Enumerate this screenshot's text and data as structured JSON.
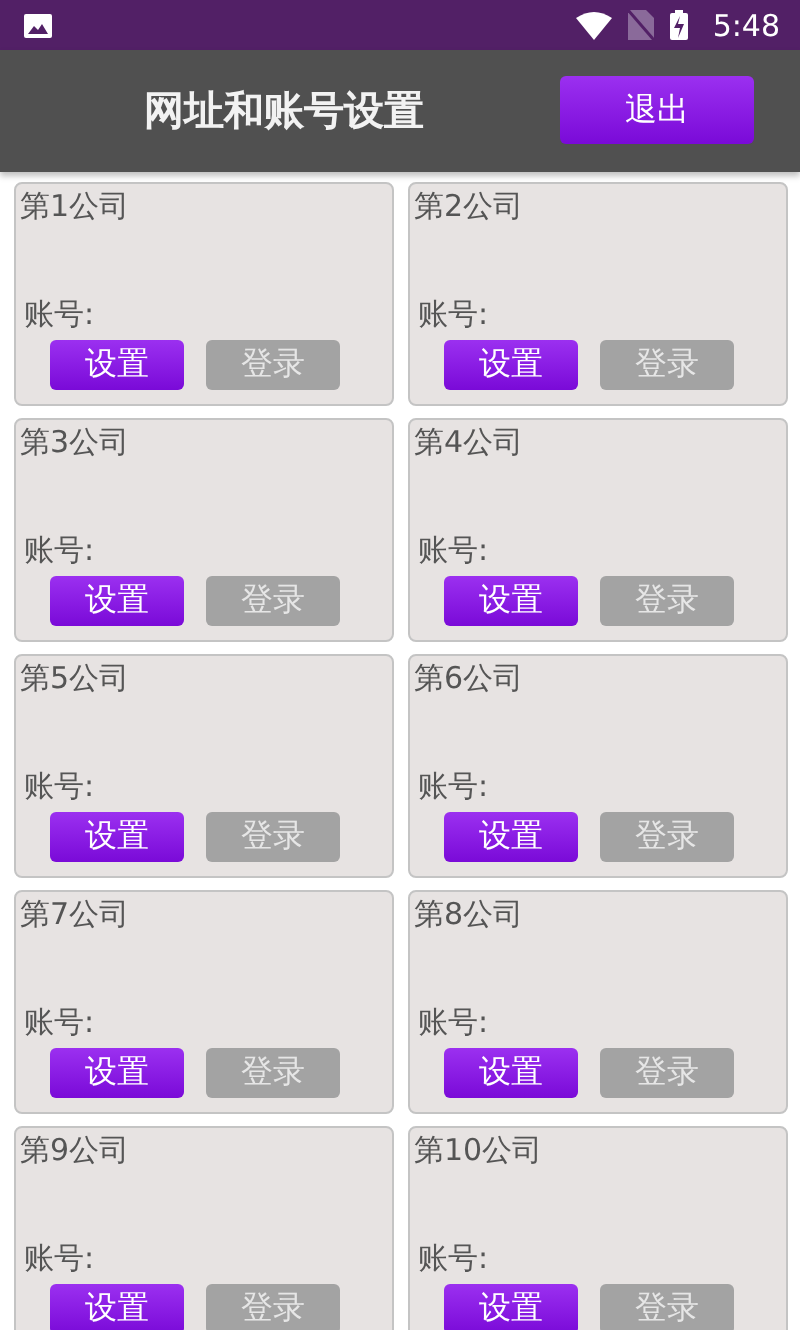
{
  "status_bar": {
    "time": "5:48"
  },
  "toolbar": {
    "title": "网址和账号设置",
    "exit_button": "退出"
  },
  "companies": [
    {
      "name": "第1公司",
      "account_label": "账号:",
      "settings_button": "设置",
      "login_button": "登录"
    },
    {
      "name": "第2公司",
      "account_label": "账号:",
      "settings_button": "设置",
      "login_button": "登录"
    },
    {
      "name": "第3公司",
      "account_label": "账号:",
      "settings_button": "设置",
      "login_button": "登录"
    },
    {
      "name": "第4公司",
      "account_label": "账号:",
      "settings_button": "设置",
      "login_button": "登录"
    },
    {
      "name": "第5公司",
      "account_label": "账号:",
      "settings_button": "设置",
      "login_button": "登录"
    },
    {
      "name": "第6公司",
      "account_label": "账号:",
      "settings_button": "设置",
      "login_button": "登录"
    },
    {
      "name": "第7公司",
      "account_label": "账号:",
      "settings_button": "设置",
      "login_button": "登录"
    },
    {
      "name": "第8公司",
      "account_label": "账号:",
      "settings_button": "设置",
      "login_button": "登录"
    },
    {
      "name": "第9公司",
      "account_label": "账号:",
      "settings_button": "设置",
      "login_button": "登录"
    },
    {
      "name": "第10公司",
      "account_label": "账号:",
      "settings_button": "设置",
      "login_button": "登录"
    }
  ]
}
